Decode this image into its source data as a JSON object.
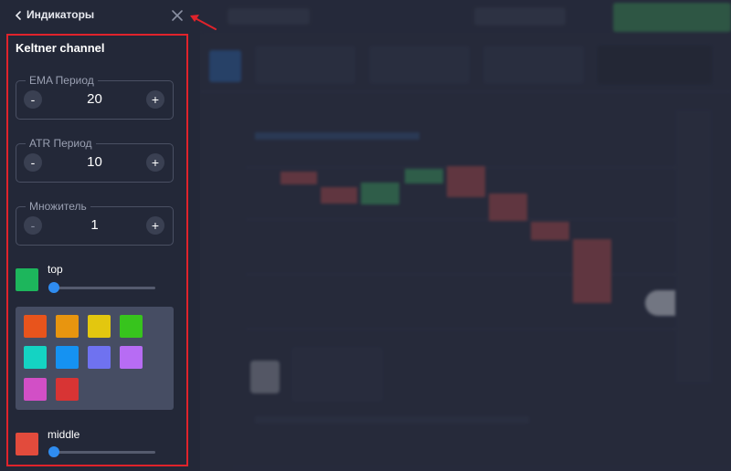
{
  "panel": {
    "title": "Индикаторы",
    "indicator_name": "Keltner channel"
  },
  "fields": [
    {
      "label": "EMA Период",
      "value": "20",
      "minus": "-",
      "plus": "+"
    },
    {
      "label": "ATR Период",
      "value": "10",
      "minus": "-",
      "plus": "+"
    },
    {
      "label": "Множитель",
      "value": "1",
      "minus": "-",
      "plus": "+"
    }
  ],
  "lines": [
    {
      "label": "top",
      "color": "#1db65c",
      "slider_level": 0.0
    },
    {
      "label": "middle",
      "color": "#e24b3c",
      "slider_level": 0.0
    }
  ],
  "palette": [
    "#e8541c",
    "#e8950f",
    "#e3c70f",
    "#37c41d",
    "#14d3c3",
    "#1592f2",
    "#6f72f0",
    "#b76cf4",
    "#d24fc6",
    "#d83434"
  ],
  "icons": {
    "back": "chevron-left-icon",
    "close": "close-icon"
  },
  "colors": {
    "annotation": "#e0232b",
    "accent": "#2f8cf0"
  }
}
